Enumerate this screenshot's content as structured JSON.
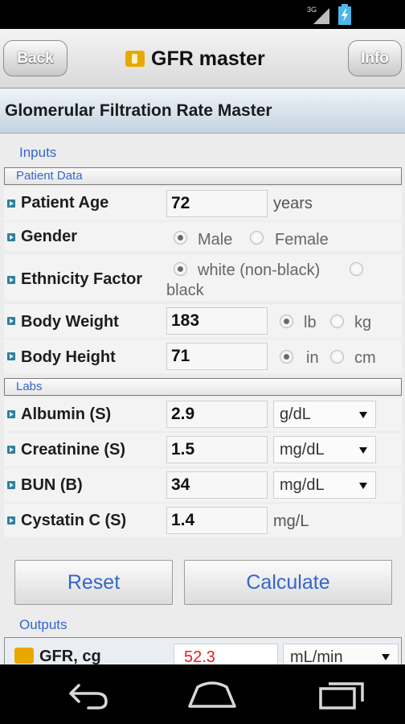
{
  "status_bar": {
    "network": "3G",
    "icons": [
      "signal-icon",
      "battery-charging-icon"
    ]
  },
  "header": {
    "back_label": "Back",
    "title": "GFR master",
    "info_label": "Info"
  },
  "subheader": {
    "title": "Glomerular Filtration Rate Master"
  },
  "inputs": {
    "section_label": "Inputs",
    "patient_data_header": "Patient Data",
    "patient_age": {
      "label": "Patient Age",
      "value": "72",
      "unit": "years"
    },
    "gender": {
      "label": "Gender",
      "options": [
        "Male",
        "Female"
      ],
      "selected": "Male"
    },
    "ethnicity": {
      "label": "Ethnicity Factor",
      "options": [
        "white (non-black)",
        "black"
      ],
      "selected": "white (non-black)"
    },
    "body_weight": {
      "label": "Body Weight",
      "value": "183",
      "options": [
        "lb",
        "kg"
      ],
      "selected": "lb"
    },
    "body_height": {
      "label": "Body Height",
      "value": "71",
      "options": [
        "in",
        "cm"
      ],
      "selected": "in"
    },
    "labs_header": "Labs",
    "albumin": {
      "label": "Albumin (S)",
      "value": "2.9",
      "unit": "g/dL"
    },
    "creatinine": {
      "label": "Creatinine (S)",
      "value": "1.5",
      "unit": "mg/dL"
    },
    "bun": {
      "label": "BUN (B)",
      "value": "34",
      "unit": "mg/dL"
    },
    "cystatin": {
      "label": "Cystatin C (S)",
      "value": "1.4",
      "unit": "mg/L"
    }
  },
  "buttons": {
    "reset": "Reset",
    "calculate": "Calculate"
  },
  "outputs": {
    "section_label": "Outputs",
    "gfr_cg": {
      "label": "GFR, cg",
      "value": "52.3",
      "unit": "mL/min"
    }
  },
  "colors": {
    "accent": "#3466cc",
    "output_value": "#e02020",
    "bullet": "#2f7f9e"
  }
}
